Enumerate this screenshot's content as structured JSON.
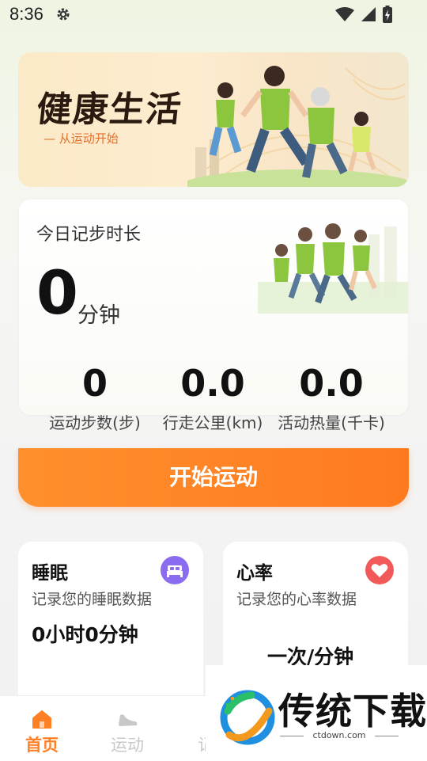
{
  "status_bar": {
    "time": "8:36"
  },
  "banner": {
    "title": "健康生活",
    "subtitle": "— 从运动开始"
  },
  "record": {
    "label": "今日记步时长",
    "value": "0",
    "unit": "分钟",
    "stats": [
      {
        "value": "0",
        "label": "运动步数(步)"
      },
      {
        "value": "0.0",
        "label": "行走公里(km)"
      },
      {
        "value": "0.0",
        "label": "活动热量(千卡)"
      }
    ]
  },
  "start_button": {
    "label": "开始运动"
  },
  "sleep_card": {
    "title": "睡眠",
    "desc": "记录您的睡眠数据",
    "value": "0小时0分钟",
    "icon": "bed-icon",
    "icon_color": "#8b6cf0"
  },
  "heart_card": {
    "title": "心率",
    "desc": "记录您的心率数据",
    "value": "一次/分钟",
    "icon": "heart-icon",
    "icon_color": "#f25a5a"
  },
  "tabs": [
    {
      "label": "首页",
      "icon": "home-icon",
      "active": true
    },
    {
      "label": "运动",
      "icon": "shoe-icon",
      "active": false
    },
    {
      "label": "记",
      "icon": "record-icon",
      "active": false
    }
  ],
  "watermark": {
    "brand": "传统下载",
    "url": "ctdown.com"
  },
  "colors": {
    "accent": "#ff7f24",
    "active_tab": "#ff7f24",
    "inactive_tab": "#c8c8c8"
  }
}
